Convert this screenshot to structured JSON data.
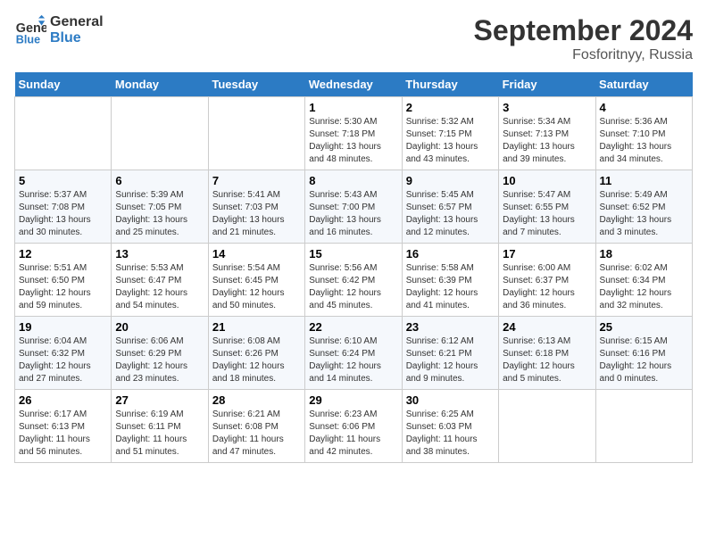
{
  "header": {
    "logo_line1": "General",
    "logo_line2": "Blue",
    "month": "September 2024",
    "location": "Fosforitnyy, Russia"
  },
  "weekdays": [
    "Sunday",
    "Monday",
    "Tuesday",
    "Wednesday",
    "Thursday",
    "Friday",
    "Saturday"
  ],
  "days": [
    {
      "num": "",
      "info": ""
    },
    {
      "num": "",
      "info": ""
    },
    {
      "num": "",
      "info": ""
    },
    {
      "num": "1",
      "info": "Sunrise: 5:30 AM\nSunset: 7:18 PM\nDaylight: 13 hours\nand 48 minutes."
    },
    {
      "num": "2",
      "info": "Sunrise: 5:32 AM\nSunset: 7:15 PM\nDaylight: 13 hours\nand 43 minutes."
    },
    {
      "num": "3",
      "info": "Sunrise: 5:34 AM\nSunset: 7:13 PM\nDaylight: 13 hours\nand 39 minutes."
    },
    {
      "num": "4",
      "info": "Sunrise: 5:36 AM\nSunset: 7:10 PM\nDaylight: 13 hours\nand 34 minutes."
    },
    {
      "num": "5",
      "info": "Sunrise: 5:37 AM\nSunset: 7:08 PM\nDaylight: 13 hours\nand 30 minutes."
    },
    {
      "num": "6",
      "info": "Sunrise: 5:39 AM\nSunset: 7:05 PM\nDaylight: 13 hours\nand 25 minutes."
    },
    {
      "num": "7",
      "info": "Sunrise: 5:41 AM\nSunset: 7:03 PM\nDaylight: 13 hours\nand 21 minutes."
    },
    {
      "num": "8",
      "info": "Sunrise: 5:43 AM\nSunset: 7:00 PM\nDaylight: 13 hours\nand 16 minutes."
    },
    {
      "num": "9",
      "info": "Sunrise: 5:45 AM\nSunset: 6:57 PM\nDaylight: 13 hours\nand 12 minutes."
    },
    {
      "num": "10",
      "info": "Sunrise: 5:47 AM\nSunset: 6:55 PM\nDaylight: 13 hours\nand 7 minutes."
    },
    {
      "num": "11",
      "info": "Sunrise: 5:49 AM\nSunset: 6:52 PM\nDaylight: 13 hours\nand 3 minutes."
    },
    {
      "num": "12",
      "info": "Sunrise: 5:51 AM\nSunset: 6:50 PM\nDaylight: 12 hours\nand 59 minutes."
    },
    {
      "num": "13",
      "info": "Sunrise: 5:53 AM\nSunset: 6:47 PM\nDaylight: 12 hours\nand 54 minutes."
    },
    {
      "num": "14",
      "info": "Sunrise: 5:54 AM\nSunset: 6:45 PM\nDaylight: 12 hours\nand 50 minutes."
    },
    {
      "num": "15",
      "info": "Sunrise: 5:56 AM\nSunset: 6:42 PM\nDaylight: 12 hours\nand 45 minutes."
    },
    {
      "num": "16",
      "info": "Sunrise: 5:58 AM\nSunset: 6:39 PM\nDaylight: 12 hours\nand 41 minutes."
    },
    {
      "num": "17",
      "info": "Sunrise: 6:00 AM\nSunset: 6:37 PM\nDaylight: 12 hours\nand 36 minutes."
    },
    {
      "num": "18",
      "info": "Sunrise: 6:02 AM\nSunset: 6:34 PM\nDaylight: 12 hours\nand 32 minutes."
    },
    {
      "num": "19",
      "info": "Sunrise: 6:04 AM\nSunset: 6:32 PM\nDaylight: 12 hours\nand 27 minutes."
    },
    {
      "num": "20",
      "info": "Sunrise: 6:06 AM\nSunset: 6:29 PM\nDaylight: 12 hours\nand 23 minutes."
    },
    {
      "num": "21",
      "info": "Sunrise: 6:08 AM\nSunset: 6:26 PM\nDaylight: 12 hours\nand 18 minutes."
    },
    {
      "num": "22",
      "info": "Sunrise: 6:10 AM\nSunset: 6:24 PM\nDaylight: 12 hours\nand 14 minutes."
    },
    {
      "num": "23",
      "info": "Sunrise: 6:12 AM\nSunset: 6:21 PM\nDaylight: 12 hours\nand 9 minutes."
    },
    {
      "num": "24",
      "info": "Sunrise: 6:13 AM\nSunset: 6:18 PM\nDaylight: 12 hours\nand 5 minutes."
    },
    {
      "num": "25",
      "info": "Sunrise: 6:15 AM\nSunset: 6:16 PM\nDaylight: 12 hours\nand 0 minutes."
    },
    {
      "num": "26",
      "info": "Sunrise: 6:17 AM\nSunset: 6:13 PM\nDaylight: 11 hours\nand 56 minutes."
    },
    {
      "num": "27",
      "info": "Sunrise: 6:19 AM\nSunset: 6:11 PM\nDaylight: 11 hours\nand 51 minutes."
    },
    {
      "num": "28",
      "info": "Sunrise: 6:21 AM\nSunset: 6:08 PM\nDaylight: 11 hours\nand 47 minutes."
    },
    {
      "num": "29",
      "info": "Sunrise: 6:23 AM\nSunset: 6:06 PM\nDaylight: 11 hours\nand 42 minutes."
    },
    {
      "num": "30",
      "info": "Sunrise: 6:25 AM\nSunset: 6:03 PM\nDaylight: 11 hours\nand 38 minutes."
    },
    {
      "num": "",
      "info": ""
    },
    {
      "num": "",
      "info": ""
    },
    {
      "num": "",
      "info": ""
    },
    {
      "num": "",
      "info": ""
    },
    {
      "num": "",
      "info": ""
    }
  ]
}
